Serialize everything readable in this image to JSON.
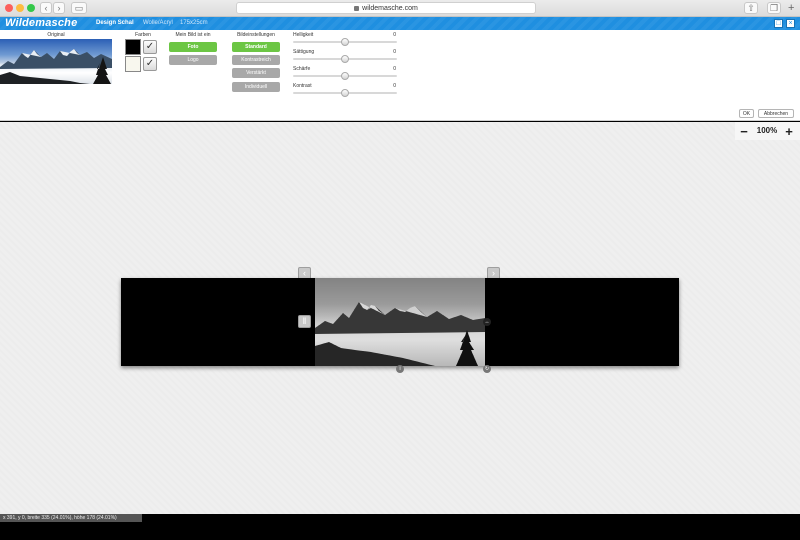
{
  "browser": {
    "url": "wildemasche.com"
  },
  "header": {
    "logo": "Wildemasche",
    "product": "Design Schal",
    "material": "Wolle/Acryl",
    "size": "175x25cm",
    "accent": "#1f8fe0"
  },
  "panel": {
    "original_title": "Original",
    "colors": {
      "title": "Farben",
      "swatch1": "#000000",
      "swatch2": "#f8f7ee"
    },
    "image_type": {
      "title": "Mein Bild ist ein",
      "options": [
        "Foto",
        "Logo"
      ],
      "selected": "Foto"
    },
    "presets": {
      "title": "Bildeinstellungen",
      "options": [
        "Standard",
        "Kontrastreich",
        "Verstärkt",
        "Individuell"
      ],
      "selected": "Standard"
    },
    "sliders": [
      {
        "label": "Helligkeit",
        "value": "0"
      },
      {
        "label": "Sättigung",
        "value": "0"
      },
      {
        "label": "Schärfe",
        "value": "0"
      },
      {
        "label": "Kontrast",
        "value": "0"
      }
    ],
    "ok_label": "OK",
    "cancel_label": "Abbrechen"
  },
  "zoom": {
    "minus": "−",
    "value": "100%",
    "plus": "+"
  },
  "status": "x 391, y 0, breite 335 (24.01%), höhe 178 (24.01%)"
}
